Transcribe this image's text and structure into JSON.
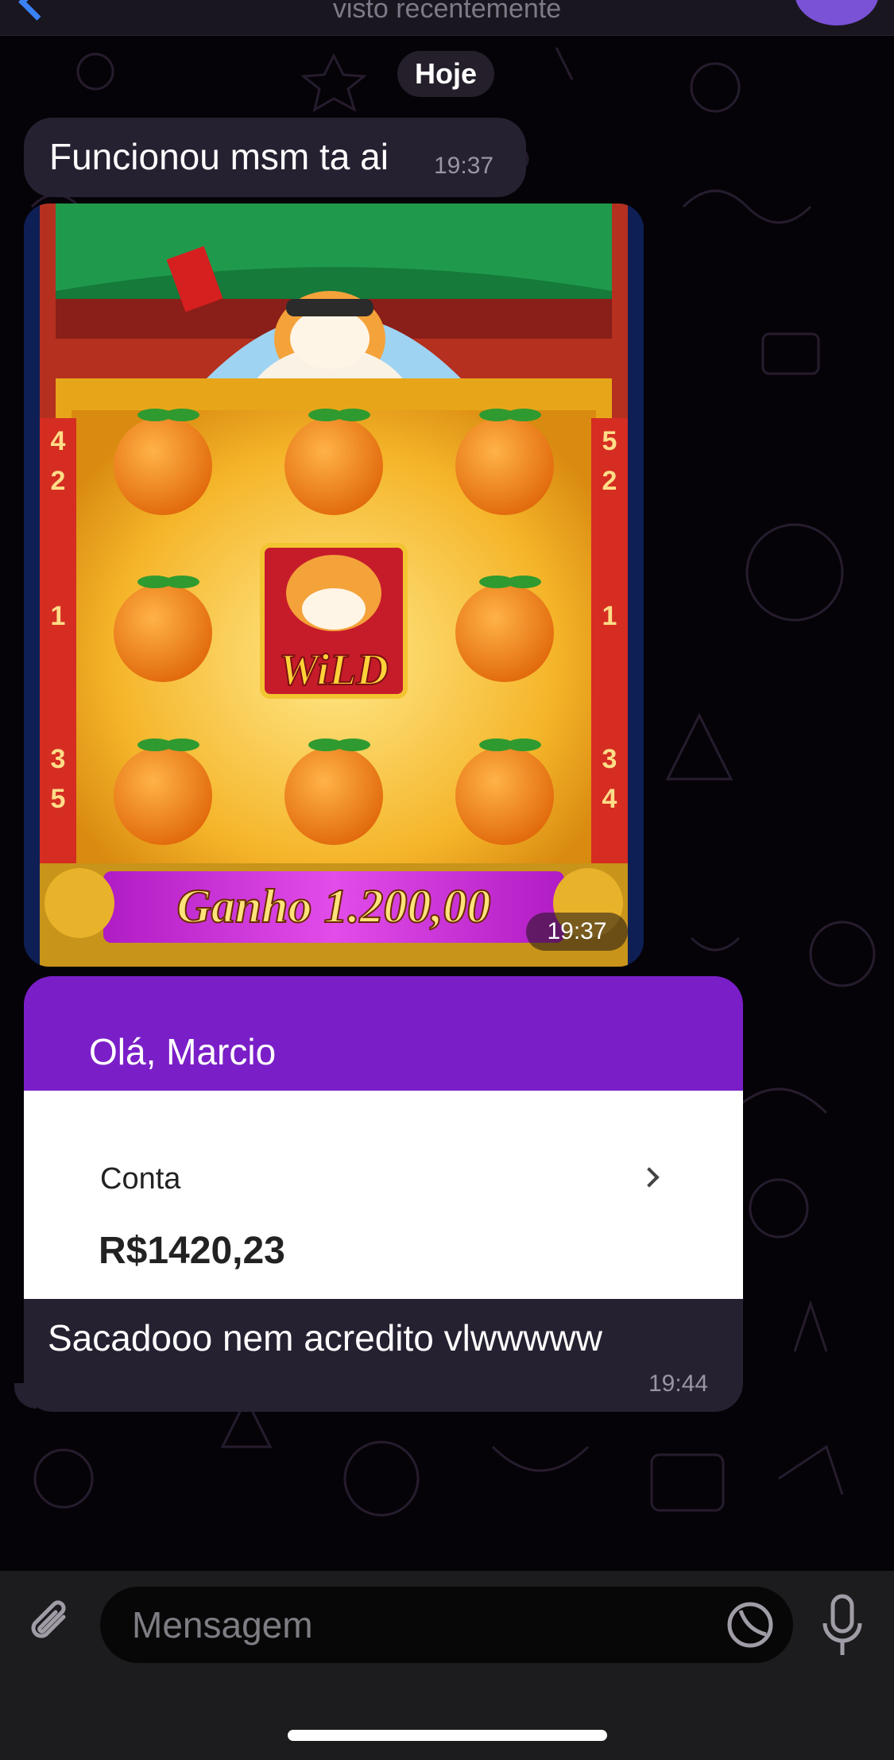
{
  "header": {
    "status_text": "visto recentemente"
  },
  "date_separator": "Hoje",
  "messages": [
    {
      "text": "Funcionou msm ta ai",
      "time": "19:37"
    },
    {
      "image": {
        "reel_numbers": {
          "left_top": [
            "4",
            "2"
          ],
          "left_mid": "1",
          "left_bottom": [
            "3",
            "5"
          ],
          "right_top": [
            "5",
            "2"
          ],
          "right_mid": "1",
          "right_bottom": [
            "3",
            "4"
          ]
        },
        "wild_label": "WiLD",
        "win_banner": "Ganho 1.200,00"
      },
      "time": "19:37"
    },
    {
      "card": {
        "greeting": "Olá, Marcio",
        "account_label": "Conta",
        "balance": "R$1420,23"
      },
      "text": "Sacadooo nem acredito vlwwwww",
      "time": "19:44"
    }
  ],
  "composer": {
    "placeholder": "Mensagem"
  },
  "colors": {
    "accent": "#3b82f6",
    "bubble": "#262131",
    "card_header": "#7a1fc8",
    "avatar": "#7a52d6"
  },
  "icons": [
    "back-chevron-icon",
    "avatar",
    "paperclip-icon",
    "sticker-icon",
    "microphone-icon",
    "chevron-right-icon"
  ]
}
